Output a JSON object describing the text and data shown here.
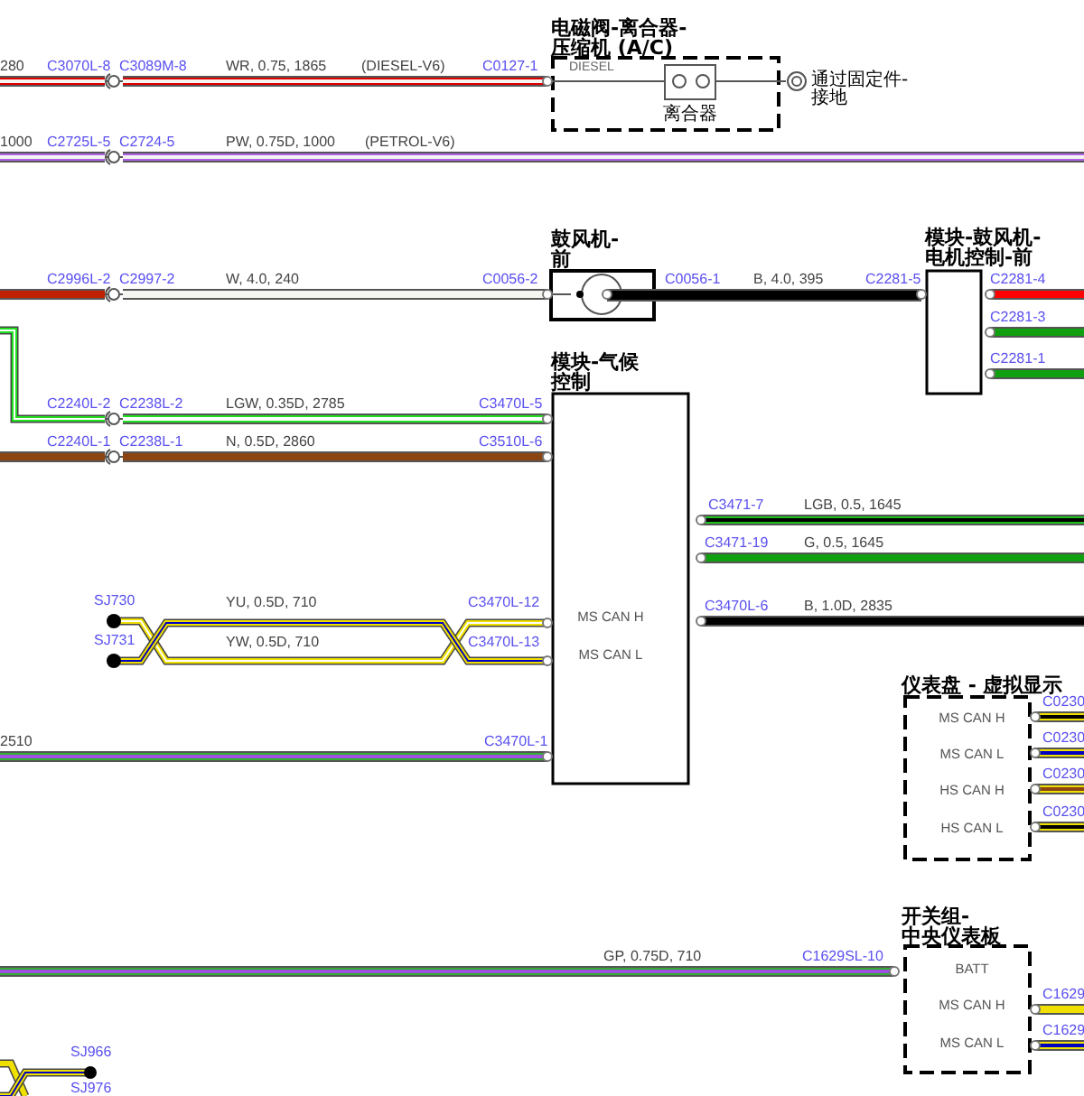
{
  "wires": [
    {
      "color": "#e00000",
      "trace": {
        "color": "#f4f4f0"
      },
      "labels": [
        {
          "text": "280",
          "kind": "spec"
        },
        {
          "text": "C3070L-8",
          "kind": "connector"
        },
        {
          "text": "C3089M-8",
          "kind": "connector"
        },
        {
          "text": "WR, 0.75, 1865",
          "kind": "spec"
        },
        {
          "text": "(DIESEL-V6)",
          "kind": "spec"
        },
        {
          "text": "C0127-1",
          "kind": "connector"
        }
      ]
    },
    {
      "color": "#b060e8",
      "trace": {
        "color": "#f4f4f0"
      },
      "labels": [
        {
          "text": "1000",
          "kind": "spec"
        },
        {
          "text": "C2725L-5",
          "kind": "connector"
        },
        {
          "text": "C2724-5",
          "kind": "connector"
        },
        {
          "text": "PW, 0.75D, 1000",
          "kind": "spec"
        },
        {
          "text": "(PETROL-V6)",
          "kind": "spec"
        }
      ]
    },
    {
      "color": "#f4f4f0",
      "lead": {
        "color": "#c02000"
      },
      "labels": [
        {
          "text": "C2996L-2",
          "kind": "connector"
        },
        {
          "text": "C2997-2",
          "kind": "connector"
        },
        {
          "text": "W, 4.0, 240",
          "kind": "spec"
        },
        {
          "text": "C0056-2",
          "kind": "connector"
        }
      ]
    },
    {
      "color": "#20e020",
      "trace": {
        "color": "#ffffff"
      },
      "labels": [
        {
          "text": "C2240L-2",
          "kind": "connector"
        },
        {
          "text": "C2238L-2",
          "kind": "connector"
        },
        {
          "text": "LGW, 0.35D, 2785",
          "kind": "spec"
        },
        {
          "text": "C3470L-5",
          "kind": "connector"
        }
      ]
    },
    {
      "color": "#8b4513",
      "labels": [
        {
          "text": "C2240L-1",
          "kind": "connector"
        },
        {
          "text": "C2238L-1",
          "kind": "connector"
        },
        {
          "text": "N, 0.5D, 2860",
          "kind": "spec"
        },
        {
          "text": "C3510L-6",
          "kind": "connector"
        }
      ]
    },
    {
      "color": "#000000",
      "labels": [
        {
          "text": "C0056-1",
          "kind": "connector"
        },
        {
          "text": "B, 4.0, 395",
          "kind": "spec"
        },
        {
          "text": "C2281-5",
          "kind": "connector"
        }
      ]
    },
    {
      "color": "#ff0000",
      "labels": [
        {
          "text": "C2281-4",
          "kind": "connector"
        }
      ]
    },
    {
      "color": "#10a010",
      "labels": [
        {
          "text": "C2281-3",
          "kind": "connector"
        }
      ]
    },
    {
      "color": "#10a010",
      "labels": [
        {
          "text": "C2281-1",
          "kind": "connector"
        }
      ]
    },
    {
      "color": "#20c020",
      "trace": {
        "color": "#000000"
      },
      "labels": [
        {
          "text": "C3471-7",
          "kind": "connector"
        },
        {
          "text": "LGB, 0.5, 1645",
          "kind": "spec"
        }
      ]
    },
    {
      "color": "#10a010",
      "labels": [
        {
          "text": "C3471-19",
          "kind": "connector"
        },
        {
          "text": "G, 0.5, 1645",
          "kind": "spec"
        }
      ]
    },
    {
      "color": "#000000",
      "labels": [
        {
          "text": "C3470L-6",
          "kind": "connector"
        },
        {
          "text": "B, 1.0D, 2835",
          "kind": "spec"
        }
      ]
    },
    {
      "color": "#30b030",
      "trace": {
        "color": "#a050e0"
      },
      "labels": [
        {
          "text": "2510",
          "kind": "spec"
        },
        {
          "text": "C3470L-1",
          "kind": "connector"
        }
      ]
    },
    {
      "color": "#30b030",
      "trace": {
        "color": "#a050e0"
      },
      "labels": [
        {
          "text": "GP, 0.75D, 710",
          "kind": "spec"
        },
        {
          "text": "C1629SL-10",
          "kind": "connector"
        }
      ]
    },
    {
      "color": "#f0e000",
      "trace": {
        "color": "#000000"
      },
      "labels": [
        {
          "text": "C0230",
          "kind": "connector"
        }
      ]
    },
    {
      "color": "#f0e000",
      "trace": {
        "color": "#0000c0"
      },
      "labels": [
        {
          "text": "C0230",
          "kind": "connector"
        }
      ]
    },
    {
      "color": "#f0e000",
      "trace": {
        "color": "#8b4513"
      },
      "labels": [
        {
          "text": "C0230",
          "kind": "connector"
        }
      ]
    },
    {
      "color": "#f0e000",
      "trace": {
        "color": "#000000"
      },
      "labels": [
        {
          "text": "C0230",
          "kind": "connector"
        }
      ]
    },
    {
      "color": "#f0e000",
      "labels": [
        {
          "text": "C1629",
          "kind": "connector"
        }
      ]
    },
    {
      "color": "#f0e000",
      "trace": {
        "color": "#0000c0"
      },
      "labels": [
        {
          "text": "C1629",
          "kind": "connector"
        }
      ]
    }
  ],
  "twisted_pairs": [
    {
      "splices": [
        "SJ730",
        "SJ731"
      ],
      "specs": [
        "YU, 0.5D, 710",
        "YW, 0.5D, 710"
      ],
      "connectors": [
        "C3470L-12",
        "C3470L-13"
      ],
      "lines": [
        {
          "color": "#f0e000",
          "trace": {
            "color": "#0000c0"
          }
        },
        {
          "color": "#f0e000",
          "trace": {
            "color": "#ffffff"
          }
        }
      ]
    },
    {
      "splices": [
        "SJ966",
        "SJ976"
      ],
      "lines": [
        {
          "color": "#f0e000",
          "trace": {
            "color": "#0000c0"
          }
        },
        {
          "color": "#f0e000"
        }
      ]
    }
  ],
  "components": [
    {
      "kind": "solenoid",
      "title": [
        "电磁阀-离合器-",
        "压缩机 (A/C)"
      ],
      "variant": "DIESEL",
      "part": "离合器",
      "ground": [
        "通过固定件-",
        "接地"
      ]
    },
    {
      "kind": "motor",
      "title": [
        "鼓风机-",
        "前"
      ]
    },
    {
      "kind": "module",
      "title": [
        "模块-鼓风机-",
        "电机控制-前"
      ]
    },
    {
      "kind": "module",
      "title": [
        "模块-气候",
        "控制"
      ],
      "pins": [
        "MS CAN H",
        "MS CAN L"
      ]
    },
    {
      "kind": "dashed",
      "title": [
        "仪表盘 - 虚拟显示"
      ],
      "pins": [
        "MS CAN H",
        "MS CAN L",
        "HS CAN H",
        "HS CAN L"
      ]
    },
    {
      "kind": "dashed",
      "title": [
        "开关组-",
        "中央仪表板"
      ],
      "pins": [
        "BATT",
        "MS CAN H",
        "MS CAN L"
      ]
    }
  ]
}
